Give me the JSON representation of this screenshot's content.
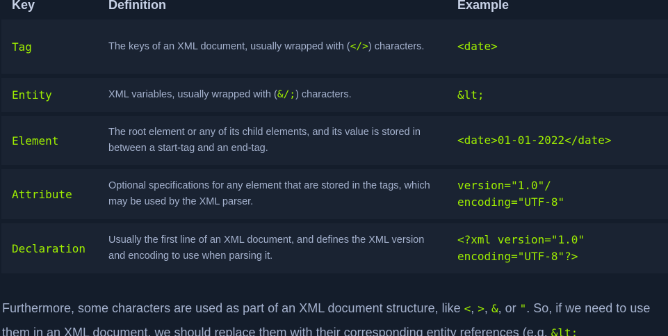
{
  "table": {
    "headers": {
      "key": "Key",
      "definition": "Definition",
      "example": "Example"
    },
    "rows": [
      {
        "key": "Tag",
        "def_pre": "The keys of an XML document, usually wrapped with (",
        "def_code": "</>",
        "def_post": ") characters.",
        "ex1": "<date>",
        "ex2": ""
      },
      {
        "key": "Entity",
        "def_pre": "XML variables, usually wrapped with (",
        "def_code": "&/;",
        "def_post": ") characters.",
        "ex1": "&lt;",
        "ex2": ""
      },
      {
        "key": "Element",
        "def_pre": "The root element or any of its child elements, and its value is stored in between a start-tag and an end-tag.",
        "def_code": "",
        "def_post": "",
        "ex1": "<date>01-01-2022</date>",
        "ex2": ""
      },
      {
        "key": "Attribute",
        "def_pre": "Optional specifications for any element that are stored in the tags, which may be used by the XML parser.",
        "def_code": "",
        "def_post": "",
        "ex1": "version=\"1.0\"/",
        "ex2": "encoding=\"UTF-8\""
      },
      {
        "key": "Declaration",
        "def_pre": "Usually the first line of an XML document, and defines the XML version and encoding to use when parsing it.",
        "def_code": "",
        "def_post": "",
        "ex1": "<?xml version=\"1.0\"",
        "ex2": "encoding=\"UTF-8\"?>"
      }
    ]
  },
  "paragraph": {
    "t1": "Furthermore, some characters are used as part of an XML document structure, like ",
    "c1": "<",
    "t2": ", ",
    "c2": ">",
    "t3": ", ",
    "c3": "&",
    "t4": ", or ",
    "c4": "\"",
    "t5": ". So, if we need to use them in an XML document, we should replace them with their corresponding entity references (e.g. ",
    "c5": "&lt;"
  },
  "colors": {
    "background": "#141d2b",
    "row_background": "#1a2332",
    "accent_green": "#9fef00",
    "text": "#a4b1cd",
    "header_text": "#c7d1e6"
  }
}
